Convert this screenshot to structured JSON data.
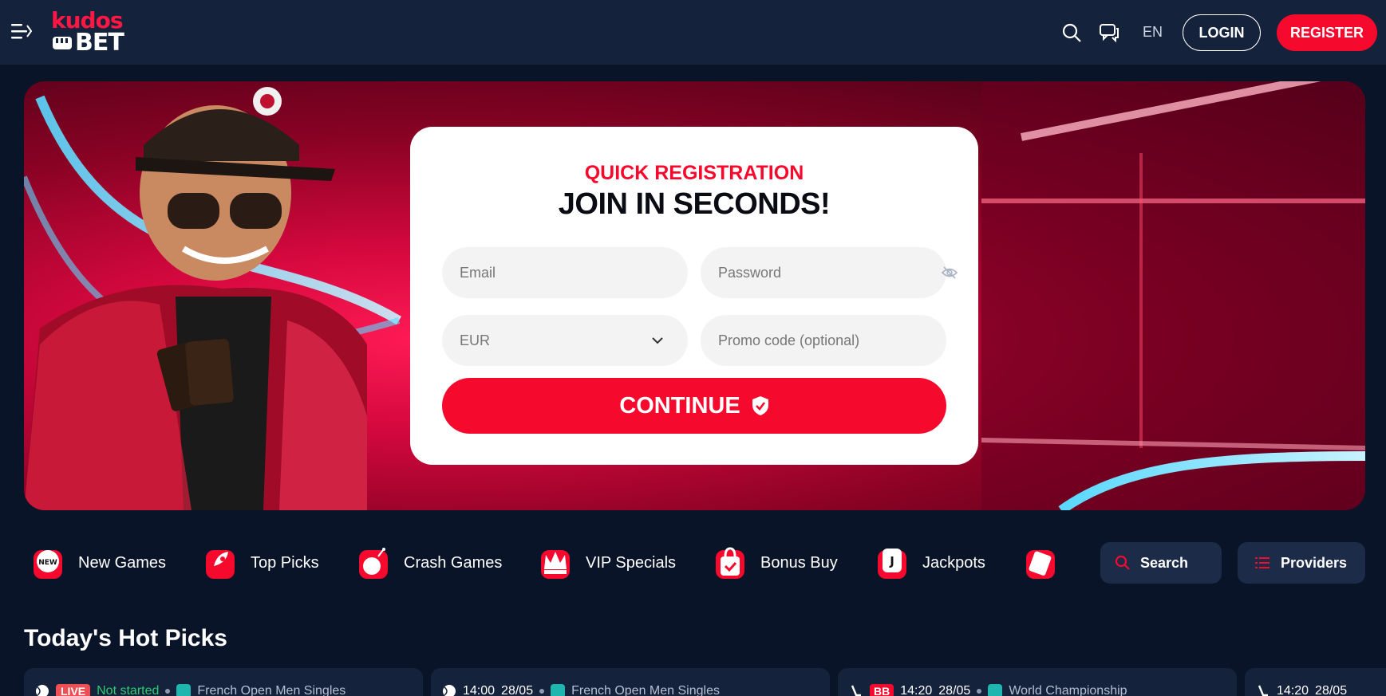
{
  "header": {
    "logo_top": "kudos",
    "logo_bottom": "BET",
    "lang": "EN",
    "login_label": "LOGIN",
    "register_label": "REGISTER",
    "icons": [
      "menu-icon",
      "search-icon",
      "chat-icon"
    ]
  },
  "registration": {
    "eyebrow": "QUICK REGISTRATION",
    "title": "JOIN IN SECONDS!",
    "email_placeholder": "Email",
    "password_placeholder": "Password",
    "currency_value": "EUR",
    "promo_placeholder": "Promo code (optional)",
    "continue_label": "CONTINUE"
  },
  "categories": [
    {
      "label": "New Games",
      "icon": "new-badge-icon"
    },
    {
      "label": "Top Picks",
      "icon": "rocket-icon"
    },
    {
      "label": "Crash Games",
      "icon": "bomb-icon"
    },
    {
      "label": "VIP Specials",
      "icon": "crown-icon"
    },
    {
      "label": "Bonus Buy",
      "icon": "shopping-bag-icon"
    },
    {
      "label": "Jackpots",
      "icon": "jackpot-card-icon"
    },
    {
      "label": "",
      "icon": "book-icon"
    }
  ],
  "tools": {
    "search_label": "Search",
    "providers_label": "Providers"
  },
  "hot_picks": {
    "title": "Today's Hot Picks",
    "cards": [
      {
        "badge": "LIVE",
        "status": "Not started",
        "tournament": "French Open Men Singles"
      },
      {
        "time": "14:00",
        "date": "28/05",
        "tournament": "French Open Men Singles"
      },
      {
        "badge": "BB",
        "time": "14:20",
        "date": "28/05",
        "tournament": "World Championship"
      },
      {
        "time": "14:20",
        "date": "28/05"
      }
    ]
  },
  "colors": {
    "accent": "#f50a2e",
    "header_bg": "#14223b",
    "page_bg": "#0a1428"
  }
}
